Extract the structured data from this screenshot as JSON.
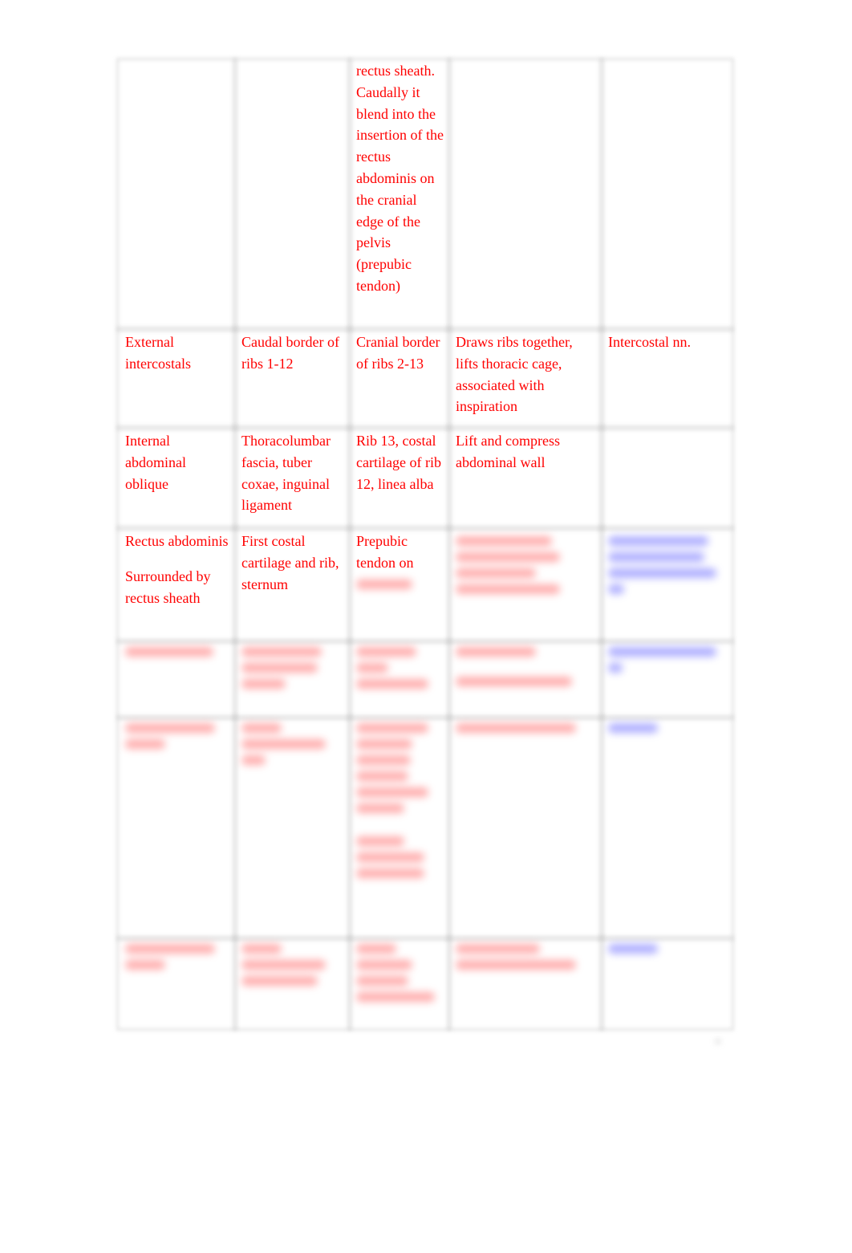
{
  "table": {
    "rows": [
      {
        "muscle": "",
        "origin": "",
        "insertion": "rectus sheath. Caudally it blend into the insertion of the rectus abdominis on the cranial edge of the pelvis (prepubic tendon)",
        "action": "",
        "innervation": ""
      },
      {
        "muscle": "External intercostals",
        "origin": "Caudal border of ribs 1-12",
        "insertion": "Cranial border of ribs 2-13",
        "action": "Draws ribs together, lifts thoracic cage, associated with inspiration",
        "innervation": "Intercostal nn."
      },
      {
        "muscle": "Internal abdominal oblique",
        "origin": "Thoracolumbar fascia, tuber coxae, inguinal ligament",
        "insertion": "Rib 13, costal cartilage of rib 12, linea alba",
        "action": "Lift and compress abdominal wall",
        "innervation": ""
      },
      {
        "muscle": "Rectus abdominis",
        "muscle_note": "Surrounded by rectus sheath",
        "origin": "First costal cartilage and rib, sternum",
        "insertion": "Prepubic tendon on",
        "insertion_obscured": true,
        "action_obscured": true,
        "innervation_obscured": true
      },
      {
        "obscured": true
      },
      {
        "obscured": true
      },
      {
        "obscured": true
      }
    ]
  },
  "colors": {
    "text_primary": "#ff0000",
    "text_link": "#0000ff",
    "grid_line": "#cdcdcd"
  },
  "page_number_obscured": true
}
